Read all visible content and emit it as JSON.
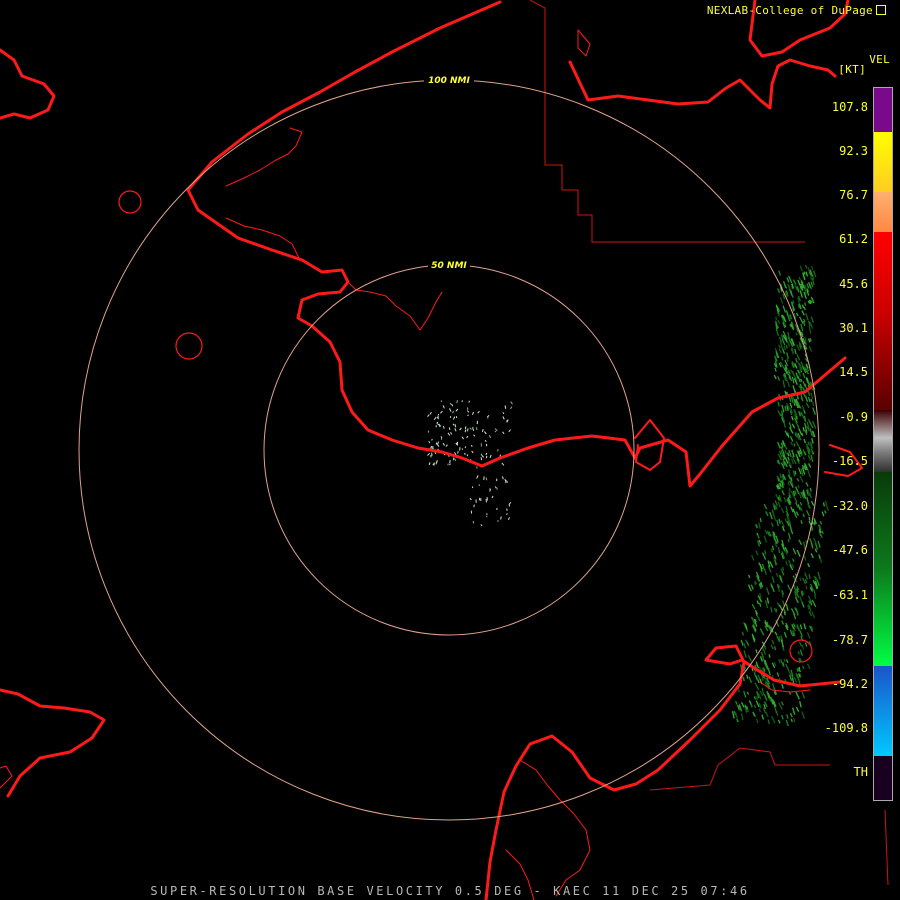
{
  "header": {
    "credit": "NEXLAB-College of DuPage",
    "product": "VEL",
    "unit": "[KT]"
  },
  "footer": {
    "caption": "SUPER-RESOLUTION BASE VELOCITY 0.5 DEG - KAEC 11 DEC 25 07:46"
  },
  "range_rings": [
    {
      "label": "100 NMI"
    },
    {
      "label": "50 NMI"
    }
  ],
  "legend": {
    "ticks": [
      "107.8",
      "92.3",
      "76.7",
      "61.2",
      "45.6",
      "30.1",
      "14.5",
      "-0.9",
      "-16.5",
      "-32.0",
      "-47.6",
      "-63.1",
      "-78.7",
      "-94.2",
      "-109.8",
      "TH"
    ],
    "colors": {
      "purple": "#7a0a8c",
      "yellow": "#ffff00",
      "orange": "#ffaa66",
      "red_top": "#ff0000",
      "red_dark": "#5a0000",
      "gray": "#b4b4b4",
      "green_dark": "#0a3a0a",
      "green_bright": "#00ff44",
      "blue": "#1e6bd6",
      "cyan": "#00c8ff",
      "th": "#1a0020"
    }
  },
  "map_colors": {
    "coastline": "#ff1a1a",
    "boundary": "#cc1515",
    "range_ring": "#e0a48a",
    "echo_inbound": "#1f8a1f",
    "echo_clutter": "#cfe8cf"
  },
  "icons": {
    "external": "external-link-icon"
  }
}
